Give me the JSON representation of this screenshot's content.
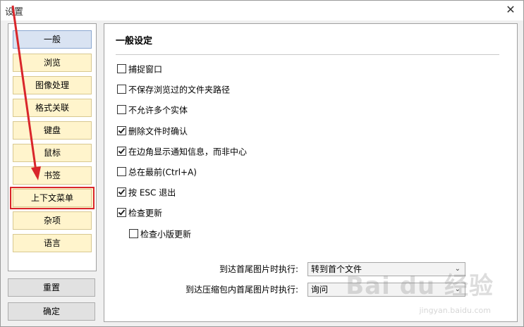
{
  "window": {
    "title": "设置",
    "close_glyph": "✕"
  },
  "nav": {
    "items": [
      {
        "label": "一般",
        "state": "active"
      },
      {
        "label": "浏览",
        "state": "normal"
      },
      {
        "label": "图像处理",
        "state": "normal"
      },
      {
        "label": "格式关联",
        "state": "normal"
      },
      {
        "label": "键盘",
        "state": "normal"
      },
      {
        "label": "鼠标",
        "state": "normal"
      },
      {
        "label": "书签",
        "state": "normal"
      },
      {
        "label": "上下文菜单",
        "state": "highlighted"
      },
      {
        "label": "杂项",
        "state": "normal"
      },
      {
        "label": "语言",
        "state": "normal"
      }
    ]
  },
  "buttons": {
    "reset_label": "重置",
    "ok_label": "确定"
  },
  "content": {
    "section_title": "一般设定",
    "options": [
      {
        "label": "捕捉窗口",
        "checked": false
      },
      {
        "label": "不保存浏览过的文件夹路径",
        "checked": false
      },
      {
        "label": "不允许多个实体",
        "checked": false
      },
      {
        "label": "删除文件时确认",
        "checked": true
      },
      {
        "label": "在边角显示通知信息，而非中心",
        "checked": true
      },
      {
        "label": "总在最前(Ctrl+A)",
        "checked": false
      },
      {
        "label": "按 ESC 退出",
        "checked": true
      },
      {
        "label": "检查更新",
        "checked": true
      },
      {
        "label": "检查小版更新",
        "checked": false
      }
    ],
    "fields": [
      {
        "label": "到达首尾图片时执行:",
        "value": "转到首个文件"
      },
      {
        "label": "到达压缩包内首尾图片时执行:",
        "value": "询问"
      }
    ]
  },
  "watermark": {
    "text": "Bai du 经验",
    "sub": "jingyan.baidu.com"
  },
  "colors": {
    "accent_red": "#d9262b",
    "nav_item_bg": "#fff4cc",
    "nav_active_bg": "#d9e3f2"
  }
}
